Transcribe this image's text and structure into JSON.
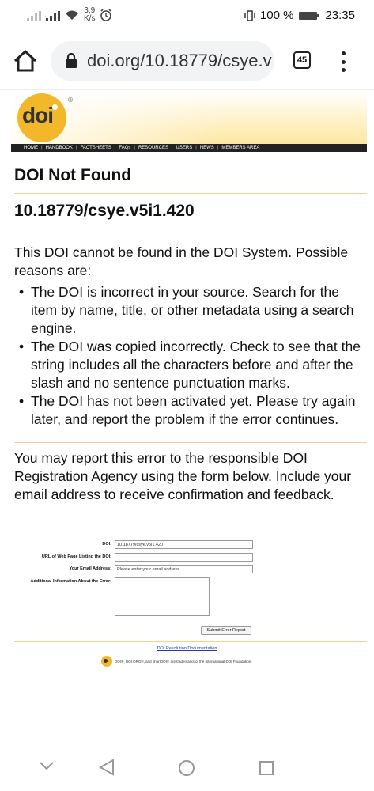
{
  "status_bar": {
    "net_speed_value": "3,9",
    "net_speed_unit": "K/s",
    "battery": "100 %",
    "time": "23:35"
  },
  "browser": {
    "url": "doi.org/10.18779/csye.v",
    "tab_count": "45"
  },
  "site": {
    "logo_text": "doi",
    "registered": "®",
    "nav": [
      "HOME",
      "HANDBOOK",
      "FACTSHEETS",
      "FAQs",
      "RESOURCES",
      "USERS",
      "NEWS",
      "MEMBERS AREA"
    ]
  },
  "page": {
    "title": "DOI Not Found",
    "doi": "10.18779/csye.v5i1.420",
    "intro": "This DOI cannot be found in the DOI System. Possible reasons are:",
    "reasons": [
      "The DOI is incorrect in your source. Search for the item by name, title, or other metadata using a search engine.",
      "The DOI was copied incorrectly. Check to see that the string includes all the characters before and after the slash and no sentence punctuation marks.",
      "The DOI has not been activated yet. Please try again later, and report the problem if the error continues."
    ],
    "report_text": "You may report this error to the responsible DOI Registration Agency using the form below. Include your email address to receive confirmation and feedback."
  },
  "form": {
    "doi_label": "DOI:",
    "doi_value": "10.18779/csye.v5i1.420",
    "url_label": "URL of Web Page Listing the DOI:",
    "url_value": "",
    "email_label": "Your Email Address:",
    "email_placeholder": "Please enter your email address",
    "info_label": "Additional Information About the Error:",
    "submit_label": "Submit Error Report"
  },
  "footer": {
    "docs_link": "DOI Resolution Documentation",
    "trademark": "DOI®, DOI.ORG®, and shortDOI® are trademarks of the International DOI Foundation."
  },
  "colors": {
    "accent": "#f2b82a",
    "nav_bg": "#222222",
    "link": "#1a3da8"
  }
}
